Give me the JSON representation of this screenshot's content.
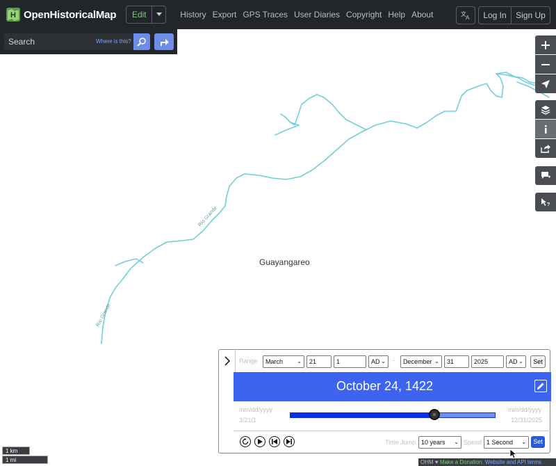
{
  "app": {
    "name": "OpenHistoricalMap",
    "edit_label": "Edit",
    "nav": [
      "History",
      "Export",
      "GPS Traces",
      "User Diaries",
      "Copyright",
      "Help",
      "About"
    ],
    "login": "Log In",
    "signup": "Sign Up"
  },
  "search": {
    "placeholder": "Search",
    "where_label": "Where is this?"
  },
  "map": {
    "place_label": "Guayangareo",
    "river_label_1": "Río Grande",
    "river_label_2": "Río Grande",
    "river_color": "#6fd0d8",
    "scale_km": "1 km",
    "scale_mi": "1 mi"
  },
  "controls": [
    "zoom-in",
    "zoom-out",
    "geolocate",
    "layers",
    "info",
    "share",
    "note",
    "query"
  ],
  "timeslider": {
    "range_label": "Range",
    "start_month": "March",
    "start_day": "21",
    "start_year": "1",
    "start_era": "AD",
    "end_month": "December",
    "end_day": "31",
    "end_year": "2025",
    "end_era": "AD",
    "set_label": "Set",
    "current_date": "October 24, 1422",
    "start_placeholder": "mm/dd/yyyy",
    "start_value": "3/21/1",
    "end_placeholder": "mm/dd/yyyy",
    "end_value": "12/31/2025",
    "position": 0.703,
    "time_jump_label": "Time Jump",
    "time_jump_value": "10 years",
    "speed_label": "Speed",
    "speed_value": "1 Second",
    "go_label": "Set",
    "accent": "#3c64f0"
  },
  "attribution": {
    "prefix": "OHM ♥",
    "donate": "Make a Donation",
    "sep": ".",
    "terms": "Website and API terms"
  }
}
